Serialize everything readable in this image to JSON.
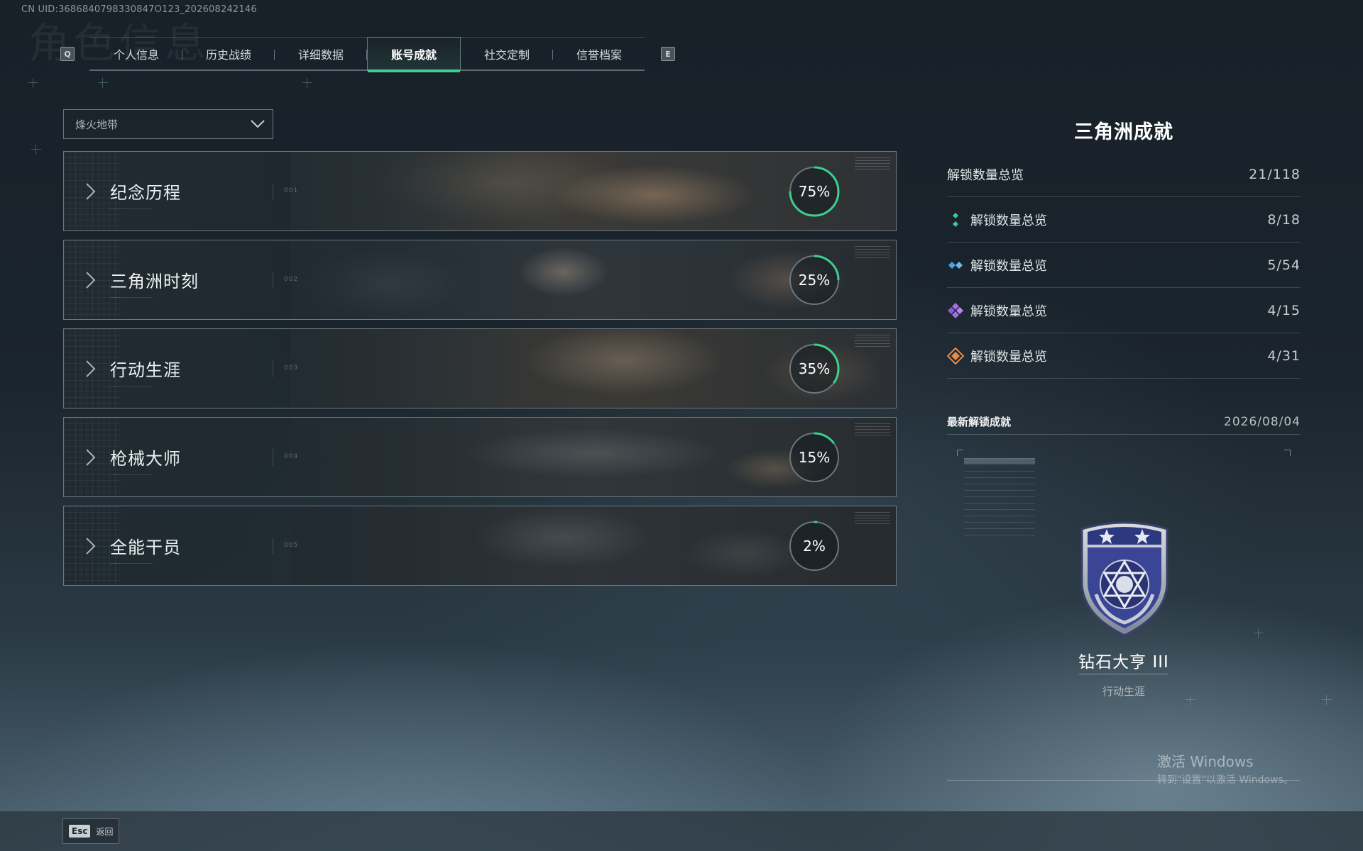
{
  "uid_text": "CN UID:3686840798330847O123_202608242146",
  "bg_title": "角色信息",
  "tabs": {
    "left_key": "Q",
    "right_key": "E",
    "items": [
      {
        "label": "个人信息"
      },
      {
        "label": "历史战绩"
      },
      {
        "label": "详细数据"
      },
      {
        "label": "账号成就"
      },
      {
        "label": "社交定制"
      },
      {
        "label": "信誉档案"
      }
    ],
    "active": "账号成就"
  },
  "filter": {
    "selected": "烽火地带",
    "icon": "chevron-down-icon"
  },
  "categories": [
    {
      "name": "纪念历程",
      "code": "001",
      "progress": 75,
      "label": "75%"
    },
    {
      "name": "三角洲时刻",
      "code": "002",
      "progress": 25,
      "label": "25%"
    },
    {
      "name": "行动生涯",
      "code": "003",
      "progress": 35,
      "label": "35%"
    },
    {
      "name": "枪械大师",
      "code": "004",
      "progress": 15,
      "label": "15%"
    },
    {
      "name": "全能干员",
      "code": "005",
      "progress": 2,
      "label": "2%"
    }
  ],
  "summary": {
    "title": "三角洲成就",
    "total": {
      "label": "解锁数量总览",
      "value": "21/118"
    },
    "tiers": [
      {
        "label": "解锁数量总览",
        "value": "8/18",
        "color": "#3ec79a",
        "icon": "green-gem-icon"
      },
      {
        "label": "解锁数量总览",
        "value": "5/54",
        "color": "#4aa3e8",
        "icon": "blue-gem-icon"
      },
      {
        "label": "解锁数量总览",
        "value": "4/15",
        "color": "#a070e0",
        "icon": "purple-gem-icon"
      },
      {
        "label": "解锁数量总览",
        "value": "4/31",
        "color": "#e88a4a",
        "icon": "orange-gem-icon"
      }
    ]
  },
  "latest": {
    "label": "最新解锁成就",
    "date": "2026/08/04",
    "badge_name": "钻石大亨 III",
    "badge_category": "行动生涯"
  },
  "watermark": {
    "line1": "激活 Windows",
    "line2": "转到\"设置\"以激活 Windows。"
  },
  "footer": {
    "esc_key": "Esc",
    "back_label": "返回"
  },
  "colors": {
    "accent": "#3ecf8e",
    "ring_track": "#6c767c"
  }
}
